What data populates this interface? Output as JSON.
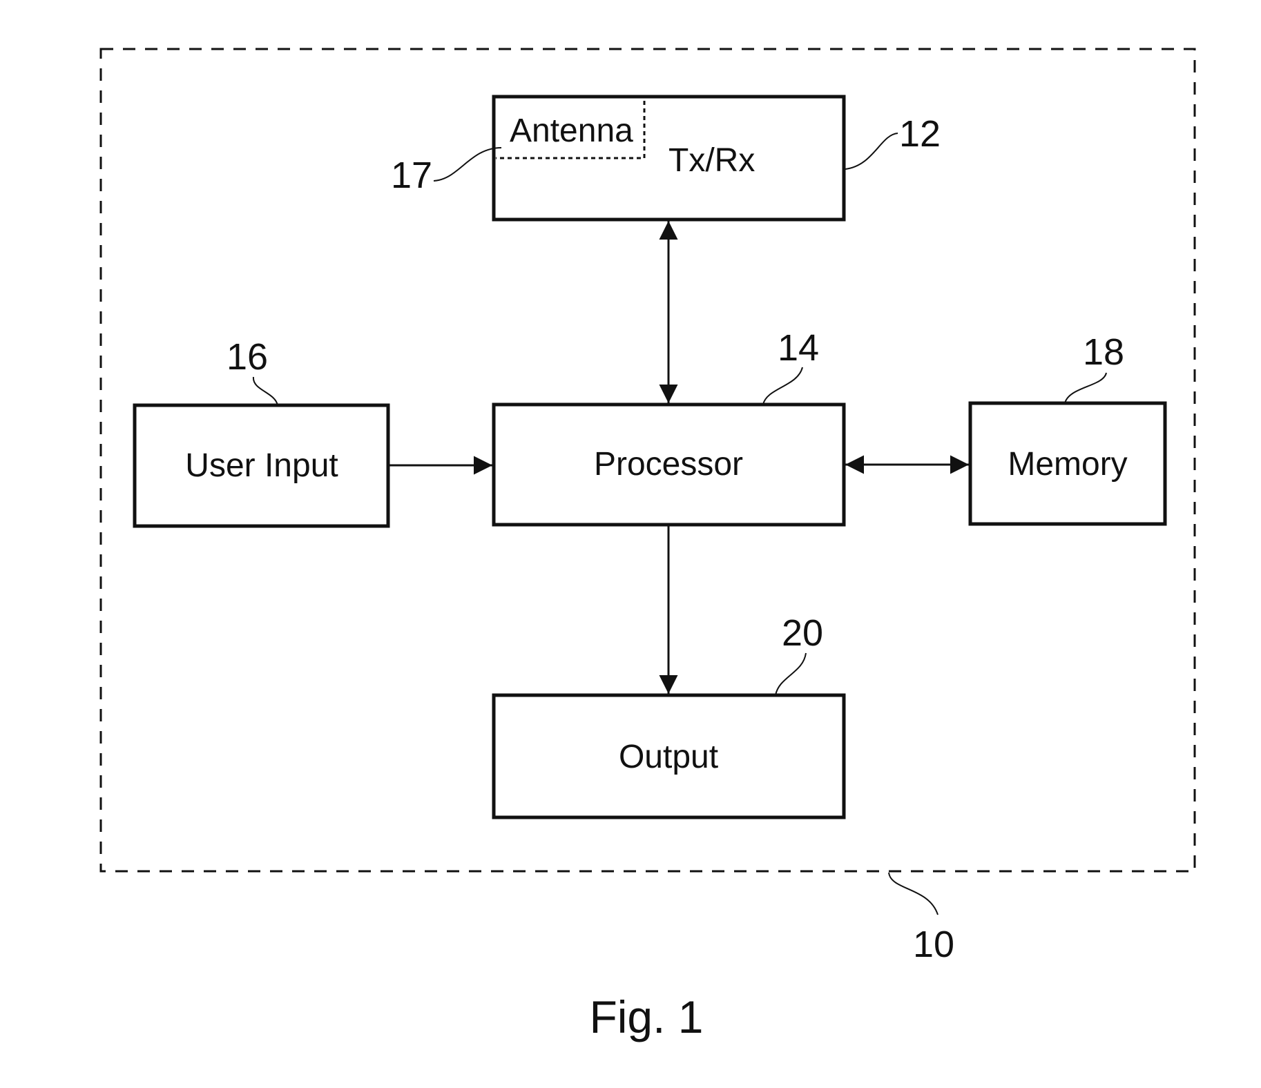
{
  "figure": {
    "caption": "Fig. 1",
    "device_ref": "10",
    "blocks": {
      "transceiver": {
        "ref": "12",
        "label": "Tx/Rx"
      },
      "antenna": {
        "ref": "17",
        "label": "Antenna"
      },
      "processor": {
        "ref": "14",
        "label": "Processor"
      },
      "user_input": {
        "ref": "16",
        "label": "User Input"
      },
      "memory": {
        "ref": "18",
        "label": "Memory"
      },
      "output": {
        "ref": "20",
        "label": "Output"
      }
    },
    "connections": [
      {
        "from": "transceiver",
        "to": "processor",
        "direction": "bidirectional"
      },
      {
        "from": "user_input",
        "to": "processor",
        "direction": "forward"
      },
      {
        "from": "processor",
        "to": "memory",
        "direction": "bidirectional"
      },
      {
        "from": "processor",
        "to": "output",
        "direction": "forward"
      }
    ]
  }
}
